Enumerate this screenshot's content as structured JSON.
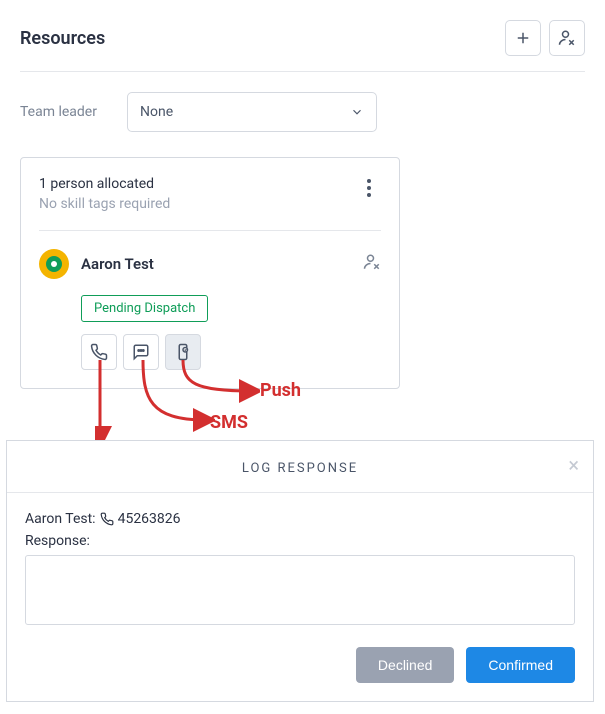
{
  "header": {
    "title": "Resources"
  },
  "team_leader": {
    "label": "Team leader",
    "value": "None"
  },
  "allocation": {
    "count_text": "1 person allocated",
    "skill_text": "No skill tags required"
  },
  "person": {
    "name": "Aaron Test",
    "status": "Pending Dispatch"
  },
  "annotations": {
    "push": "Push",
    "sms": "SMS"
  },
  "modal": {
    "title": "LOG RESPONSE",
    "contact_name": "Aaron Test:",
    "contact_number": "45263826",
    "response_label": "Response:",
    "response_value": "",
    "declined_label": "Declined",
    "confirmed_label": "Confirmed"
  }
}
